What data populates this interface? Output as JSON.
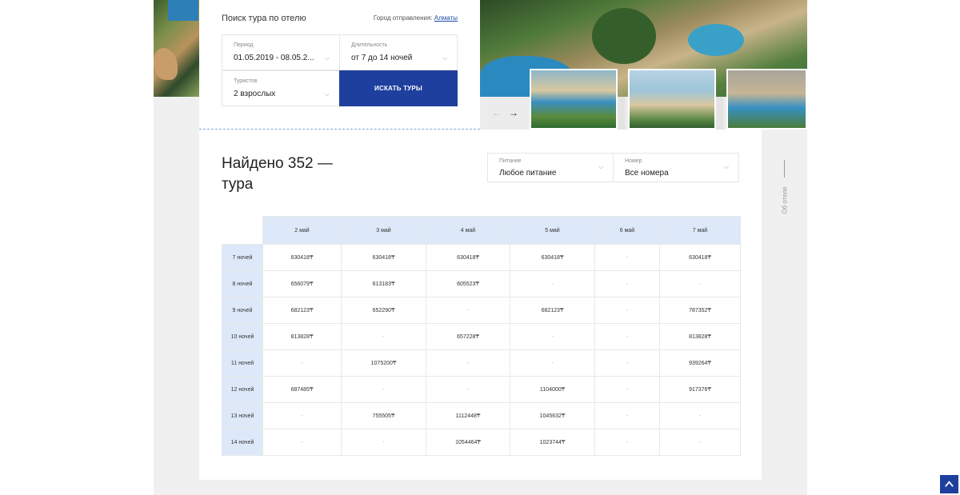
{
  "search": {
    "title": "Поиск тура по отелю",
    "city_label": "Город отправления:",
    "city_value": "Алматы",
    "period_label": "Период",
    "period_value": "01.05.2019 - 08.05.2...",
    "duration_label": "Длительность",
    "duration_value": "от 7 до 14 ночей",
    "tourists_label": "Туристов",
    "tourists_value": "2 взрослых",
    "button": "ИСКАТЬ ТУРЫ"
  },
  "gallery": {
    "prev_icon": "arrow-left-icon",
    "next_icon": "arrow-right-icon",
    "prev_glyph": "←",
    "next_glyph": "→"
  },
  "results": {
    "found": "Найдено 352 — тура",
    "filters": {
      "meal_label": "Питание",
      "meal_value": "Любое питание",
      "room_label": "Номер",
      "room_value": "Все номера"
    },
    "side_tab": "Об отеле"
  },
  "table": {
    "columns": [
      "2 май",
      "3 май",
      "4 май",
      "5 май",
      "6 май",
      "7 май"
    ],
    "rows": [
      {
        "label": "7 ночей",
        "cells": [
          "630418₸",
          "630418₸",
          "630418₸",
          "630418₸",
          "-",
          "630418₸"
        ]
      },
      {
        "label": "8 ночей",
        "cells": [
          "656079₸",
          "613183₸",
          "605523₸",
          "-",
          "-",
          "-"
        ]
      },
      {
        "label": "9 ночей",
        "cells": [
          "682123₸",
          "652290₸",
          "-",
          "682123₸",
          "-",
          "787352₸"
        ]
      },
      {
        "label": "10 ночей",
        "cells": [
          "813828₸",
          "-",
          "657228₸",
          "-",
          "-",
          "813828₸"
        ]
      },
      {
        "label": "11 ночей",
        "cells": [
          "-",
          "1075200₸",
          "-",
          "-",
          "-",
          "939264₸"
        ]
      },
      {
        "label": "12 ночей",
        "cells": [
          "687485₸",
          "-",
          "-",
          "1104000₸",
          "-",
          "917376₸"
        ]
      },
      {
        "label": "13 ночей",
        "cells": [
          "-",
          "755505₸",
          "1112448₸",
          "1045632₸",
          "-",
          "-"
        ]
      },
      {
        "label": "14 ночей",
        "cells": [
          "-",
          "-",
          "1054464₸",
          "1023744₸",
          "-",
          "-"
        ]
      }
    ]
  },
  "colors": {
    "accent": "#1f3f9e",
    "table_header_bg": "#dde9f8",
    "link": "#1a4ea8"
  }
}
